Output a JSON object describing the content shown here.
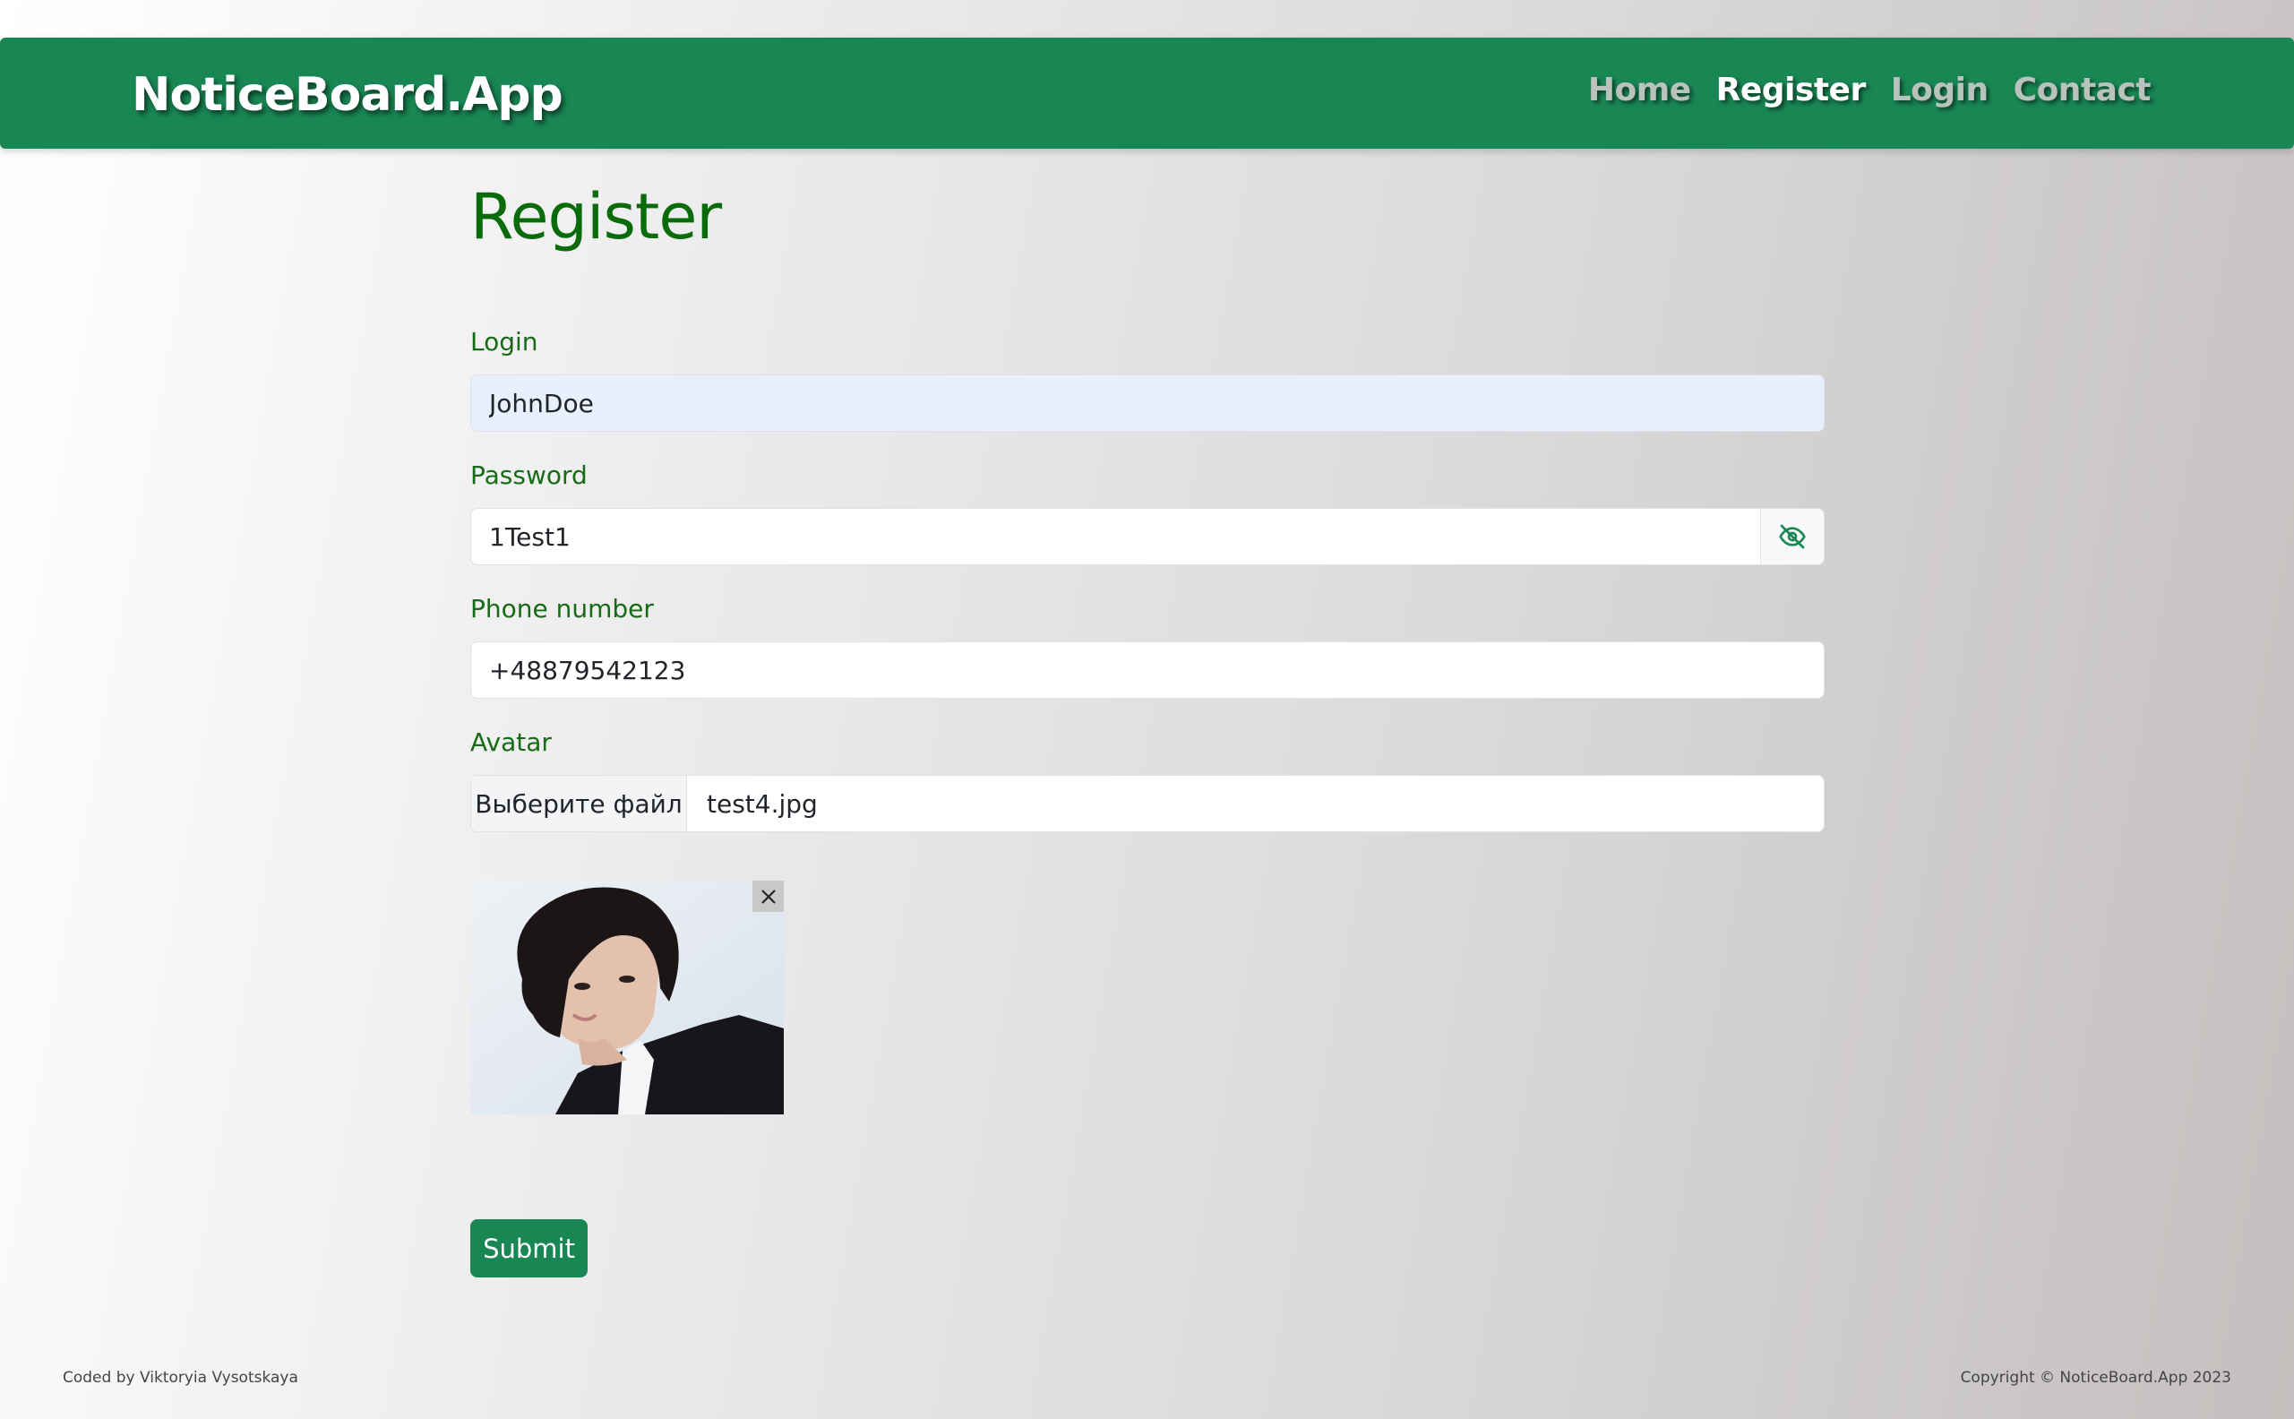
{
  "navbar": {
    "brand": "NoticeBoard.App",
    "links": [
      {
        "label": "Home",
        "active": false
      },
      {
        "label": "Register",
        "active": true
      },
      {
        "label": "Login",
        "active": false
      },
      {
        "label": "Contact",
        "active": false
      }
    ]
  },
  "form": {
    "title": "Register",
    "login": {
      "label": "Login",
      "value": "JohnDoe"
    },
    "password": {
      "label": "Password",
      "value": "1Test1",
      "toggle_icon": "eye-slash-icon"
    },
    "phone": {
      "label": "Phone number",
      "value": "+48879542123"
    },
    "avatar": {
      "label": "Avatar",
      "button_label": "Выберите файл",
      "file_name": "test4.jpg",
      "remove_icon": "close-icon"
    },
    "submit_label": "Submit"
  },
  "footer": {
    "left": "Coded by Viktoryia Vysotskaya",
    "right": "Copyright © NoticeBoard.App 2023"
  },
  "colors": {
    "primary": "#198754",
    "title": "#0a6b0a",
    "label": "#166b16"
  }
}
